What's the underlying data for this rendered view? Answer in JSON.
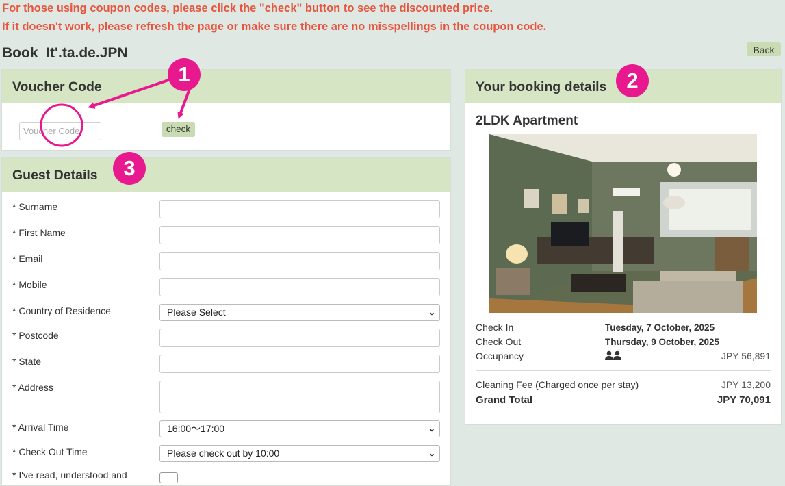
{
  "notice": {
    "line1": "For those using coupon codes, please click the \"check\" button to see the discounted price.",
    "line2": "If it doesn't work, please refresh the page or make sure there are no misspellings in the coupon code."
  },
  "header": {
    "title": "Book  It'.ta.de.JPN",
    "back_label": "Back"
  },
  "voucher": {
    "heading": "Voucher Code",
    "placeholder": "Voucher Code",
    "check_label": "check"
  },
  "guest": {
    "heading": "Guest Details",
    "fields": [
      {
        "label": "*  Surname"
      },
      {
        "label": "*  First Name"
      },
      {
        "label": "*  Email"
      },
      {
        "label": "*  Mobile"
      },
      {
        "label": "*  Country of Residence",
        "value": "Please Select"
      },
      {
        "label": "*  Postcode"
      },
      {
        "label": "*  State"
      },
      {
        "label": "*  Address"
      },
      {
        "label": "*  Arrival Time",
        "value": "16:00～17:00"
      },
      {
        "label": "*  Check Out Time",
        "value": "Please check out by 10:00"
      },
      {
        "label": "*  I've read, understood and"
      }
    ]
  },
  "booking": {
    "heading": "Your booking details",
    "room_name": "2LDK Apartment",
    "check_in_label": "Check In",
    "check_in_value": "Tuesday, 7 October, 2025",
    "check_out_label": "Check Out",
    "check_out_value": "Thursday, 9 October, 2025",
    "occupancy_label": "Occupancy",
    "occupancy_price": "JPY 56,891",
    "cleaning_label": "Cleaning Fee (Charged once per stay)",
    "cleaning_price": "JPY 13,200",
    "total_label": "Grand Total",
    "total_price": "JPY 70,091"
  },
  "annotations": {
    "badge1": "1",
    "badge2": "2",
    "badge3": "3",
    "color": "#e8188f"
  },
  "colors": {
    "background": "#dfe8e2",
    "notice": "#e8553f",
    "panel_header": "#d6e5c4",
    "button": "#c9dbb2"
  }
}
